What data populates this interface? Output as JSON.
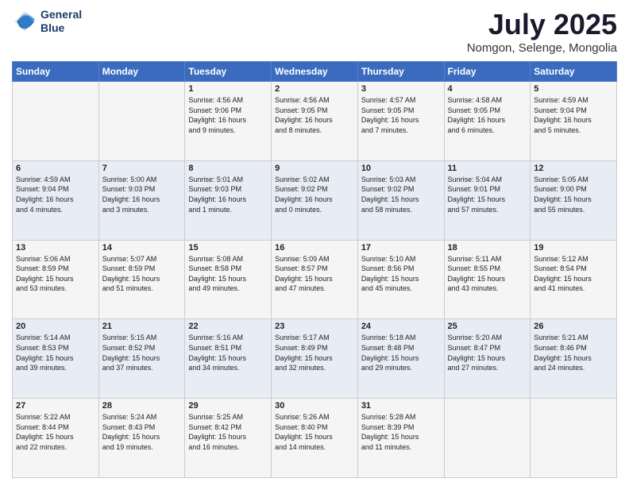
{
  "header": {
    "logo_line1": "General",
    "logo_line2": "Blue",
    "month": "July 2025",
    "location": "Nomgon, Selenge, Mongolia"
  },
  "weekdays": [
    "Sunday",
    "Monday",
    "Tuesday",
    "Wednesday",
    "Thursday",
    "Friday",
    "Saturday"
  ],
  "weeks": [
    [
      {
        "num": "",
        "info": ""
      },
      {
        "num": "",
        "info": ""
      },
      {
        "num": "1",
        "info": "Sunrise: 4:56 AM\nSunset: 9:06 PM\nDaylight: 16 hours\nand 9 minutes."
      },
      {
        "num": "2",
        "info": "Sunrise: 4:56 AM\nSunset: 9:05 PM\nDaylight: 16 hours\nand 8 minutes."
      },
      {
        "num": "3",
        "info": "Sunrise: 4:57 AM\nSunset: 9:05 PM\nDaylight: 16 hours\nand 7 minutes."
      },
      {
        "num": "4",
        "info": "Sunrise: 4:58 AM\nSunset: 9:05 PM\nDaylight: 16 hours\nand 6 minutes."
      },
      {
        "num": "5",
        "info": "Sunrise: 4:59 AM\nSunset: 9:04 PM\nDaylight: 16 hours\nand 5 minutes."
      }
    ],
    [
      {
        "num": "6",
        "info": "Sunrise: 4:59 AM\nSunset: 9:04 PM\nDaylight: 16 hours\nand 4 minutes."
      },
      {
        "num": "7",
        "info": "Sunrise: 5:00 AM\nSunset: 9:03 PM\nDaylight: 16 hours\nand 3 minutes."
      },
      {
        "num": "8",
        "info": "Sunrise: 5:01 AM\nSunset: 9:03 PM\nDaylight: 16 hours\nand 1 minute."
      },
      {
        "num": "9",
        "info": "Sunrise: 5:02 AM\nSunset: 9:02 PM\nDaylight: 16 hours\nand 0 minutes."
      },
      {
        "num": "10",
        "info": "Sunrise: 5:03 AM\nSunset: 9:02 PM\nDaylight: 15 hours\nand 58 minutes."
      },
      {
        "num": "11",
        "info": "Sunrise: 5:04 AM\nSunset: 9:01 PM\nDaylight: 15 hours\nand 57 minutes."
      },
      {
        "num": "12",
        "info": "Sunrise: 5:05 AM\nSunset: 9:00 PM\nDaylight: 15 hours\nand 55 minutes."
      }
    ],
    [
      {
        "num": "13",
        "info": "Sunrise: 5:06 AM\nSunset: 8:59 PM\nDaylight: 15 hours\nand 53 minutes."
      },
      {
        "num": "14",
        "info": "Sunrise: 5:07 AM\nSunset: 8:59 PM\nDaylight: 15 hours\nand 51 minutes."
      },
      {
        "num": "15",
        "info": "Sunrise: 5:08 AM\nSunset: 8:58 PM\nDaylight: 15 hours\nand 49 minutes."
      },
      {
        "num": "16",
        "info": "Sunrise: 5:09 AM\nSunset: 8:57 PM\nDaylight: 15 hours\nand 47 minutes."
      },
      {
        "num": "17",
        "info": "Sunrise: 5:10 AM\nSunset: 8:56 PM\nDaylight: 15 hours\nand 45 minutes."
      },
      {
        "num": "18",
        "info": "Sunrise: 5:11 AM\nSunset: 8:55 PM\nDaylight: 15 hours\nand 43 minutes."
      },
      {
        "num": "19",
        "info": "Sunrise: 5:12 AM\nSunset: 8:54 PM\nDaylight: 15 hours\nand 41 minutes."
      }
    ],
    [
      {
        "num": "20",
        "info": "Sunrise: 5:14 AM\nSunset: 8:53 PM\nDaylight: 15 hours\nand 39 minutes."
      },
      {
        "num": "21",
        "info": "Sunrise: 5:15 AM\nSunset: 8:52 PM\nDaylight: 15 hours\nand 37 minutes."
      },
      {
        "num": "22",
        "info": "Sunrise: 5:16 AM\nSunset: 8:51 PM\nDaylight: 15 hours\nand 34 minutes."
      },
      {
        "num": "23",
        "info": "Sunrise: 5:17 AM\nSunset: 8:49 PM\nDaylight: 15 hours\nand 32 minutes."
      },
      {
        "num": "24",
        "info": "Sunrise: 5:18 AM\nSunset: 8:48 PM\nDaylight: 15 hours\nand 29 minutes."
      },
      {
        "num": "25",
        "info": "Sunrise: 5:20 AM\nSunset: 8:47 PM\nDaylight: 15 hours\nand 27 minutes."
      },
      {
        "num": "26",
        "info": "Sunrise: 5:21 AM\nSunset: 8:46 PM\nDaylight: 15 hours\nand 24 minutes."
      }
    ],
    [
      {
        "num": "27",
        "info": "Sunrise: 5:22 AM\nSunset: 8:44 PM\nDaylight: 15 hours\nand 22 minutes."
      },
      {
        "num": "28",
        "info": "Sunrise: 5:24 AM\nSunset: 8:43 PM\nDaylight: 15 hours\nand 19 minutes."
      },
      {
        "num": "29",
        "info": "Sunrise: 5:25 AM\nSunset: 8:42 PM\nDaylight: 15 hours\nand 16 minutes."
      },
      {
        "num": "30",
        "info": "Sunrise: 5:26 AM\nSunset: 8:40 PM\nDaylight: 15 hours\nand 14 minutes."
      },
      {
        "num": "31",
        "info": "Sunrise: 5:28 AM\nSunset: 8:39 PM\nDaylight: 15 hours\nand 11 minutes."
      },
      {
        "num": "",
        "info": ""
      },
      {
        "num": "",
        "info": ""
      }
    ]
  ]
}
